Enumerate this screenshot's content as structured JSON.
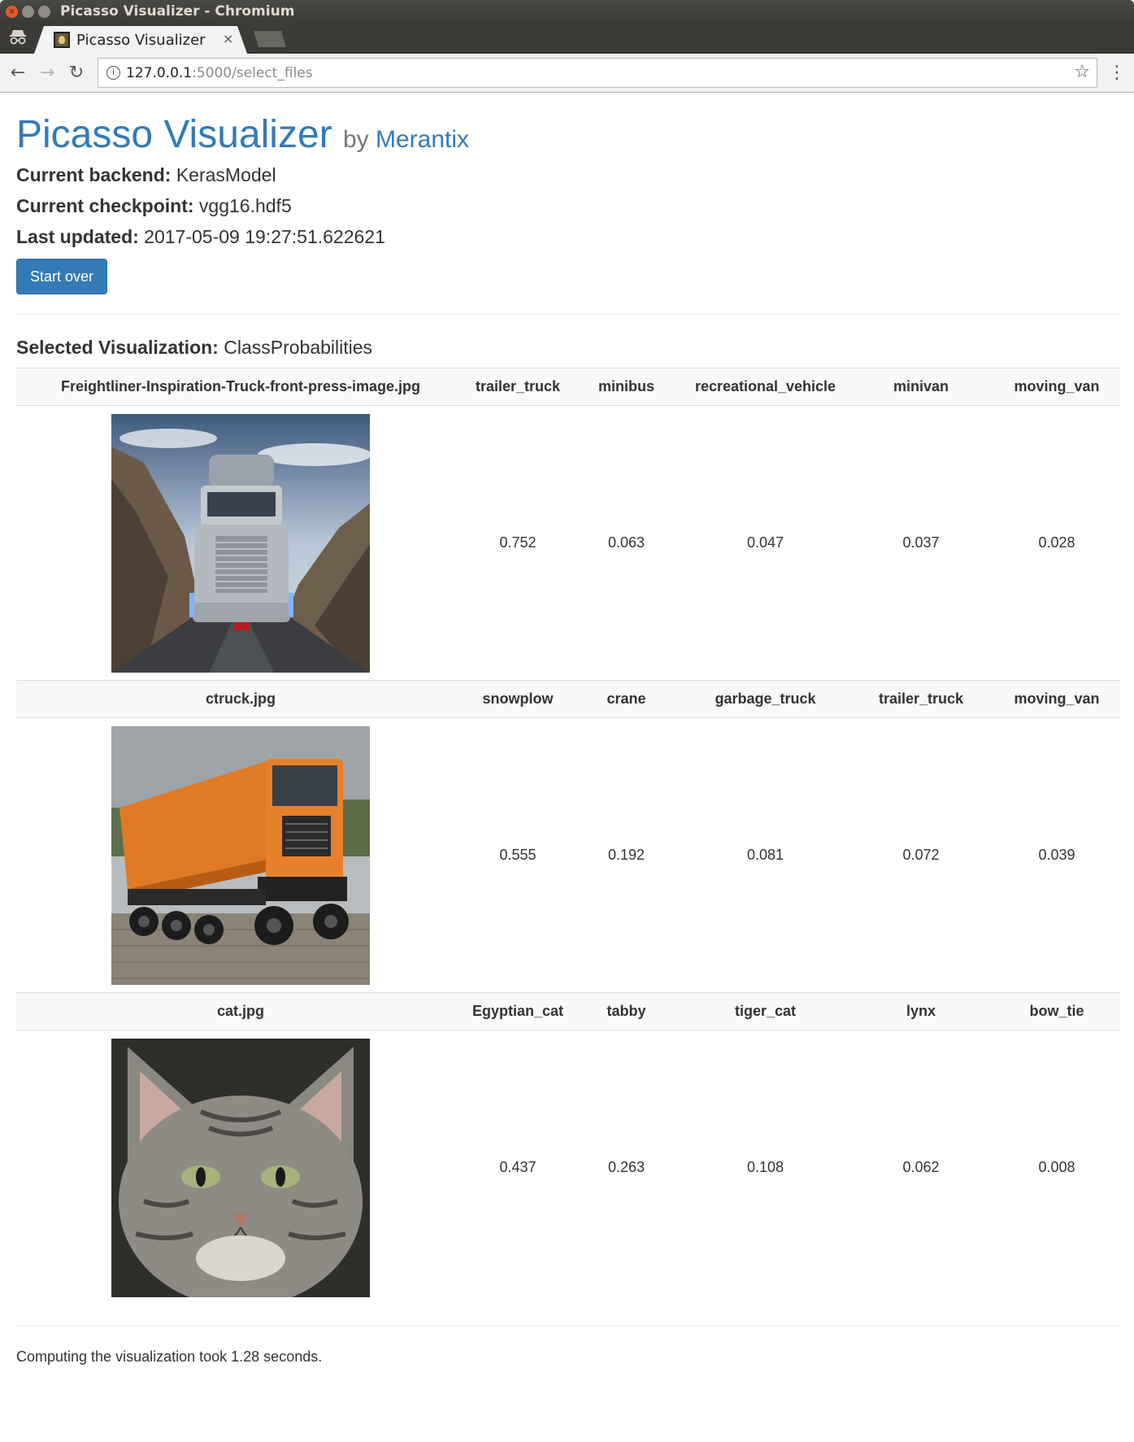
{
  "window": {
    "title": "Picasso Visualizer - Chromium"
  },
  "tab": {
    "title": "Picasso Visualizer",
    "close": "×"
  },
  "address_bar": {
    "host": "127.0.0.1",
    "path": ":5000/select_files"
  },
  "header": {
    "title": "Picasso Visualizer",
    "by": "by",
    "by_link": "Merantix"
  },
  "info": {
    "backend_label": "Current backend:",
    "backend_value": "KerasModel",
    "checkpoint_label": "Current checkpoint:",
    "checkpoint_value": "vgg16.hdf5",
    "updated_label": "Last updated:",
    "updated_value": "2017-05-09 19:27:51.622621"
  },
  "start_over_label": "Start over",
  "selected_visualization": {
    "label": "Selected Visualization:",
    "value": "ClassProbabilities"
  },
  "results": [
    {
      "filename": "Freightliner-Inspiration-Truck-front-press-image.jpg",
      "image": "truck-photo",
      "classes": [
        "trailer_truck",
        "minibus",
        "recreational_vehicle",
        "minivan",
        "moving_van"
      ],
      "probs": [
        "0.752",
        "0.063",
        "0.047",
        "0.037",
        "0.028"
      ]
    },
    {
      "filename": "ctruck.jpg",
      "image": "dump-truck-photo",
      "classes": [
        "snowplow",
        "crane",
        "garbage_truck",
        "trailer_truck",
        "moving_van"
      ],
      "probs": [
        "0.555",
        "0.192",
        "0.081",
        "0.072",
        "0.039"
      ]
    },
    {
      "filename": "cat.jpg",
      "image": "cat-photo",
      "classes": [
        "Egyptian_cat",
        "tabby",
        "tiger_cat",
        "lynx",
        "bow_tie"
      ],
      "probs": [
        "0.437",
        "0.263",
        "0.108",
        "0.062",
        "0.008"
      ]
    }
  ],
  "footer_text": "Computing the visualization took 1.28 seconds."
}
